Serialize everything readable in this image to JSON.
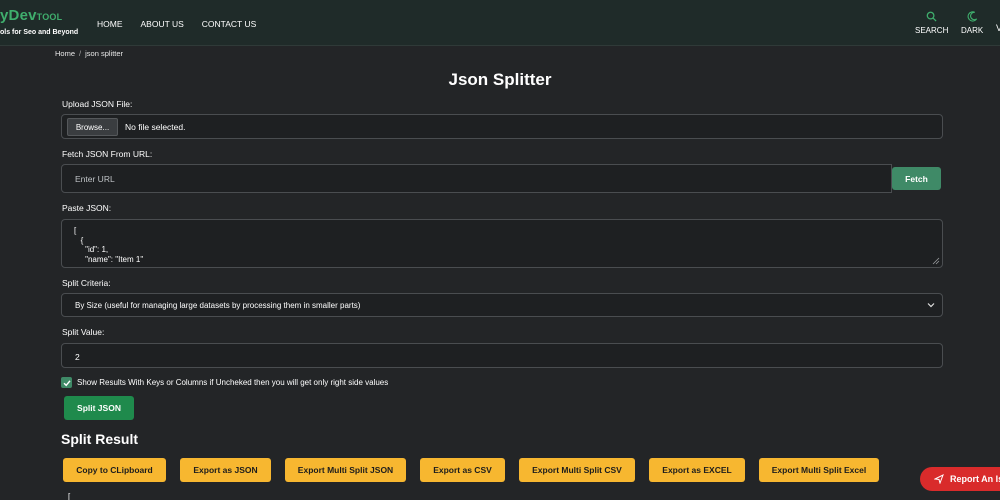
{
  "header": {
    "logo_main": "yDev",
    "logo_tool": "TOOL",
    "logo_tagline": "ols for Seo and Beyond",
    "nav": [
      "HOME",
      "ABOUT US",
      "CONTACT US"
    ],
    "search_label": "SEARCH",
    "dark_label": "DARK",
    "cut_label": "V"
  },
  "breadcrumb": {
    "home": "Home",
    "separator": "/",
    "current": "json splitter"
  },
  "page_title": "Json Splitter",
  "upload": {
    "label": "Upload JSON File:",
    "browse": "Browse...",
    "status": "No file selected."
  },
  "fetch": {
    "label": "Fetch JSON From URL:",
    "placeholder": "Enter URL",
    "button": "Fetch"
  },
  "paste": {
    "label": "Paste JSON:",
    "value": "[\n   {\n     \"id\": 1,\n     \"name\": \"Item 1\""
  },
  "criteria": {
    "label": "Split Criteria:",
    "selected": "By Size (useful for managing large datasets by processing them in smaller parts)"
  },
  "split_value": {
    "label": "Split Value:",
    "value": "2"
  },
  "option": {
    "label": "Show Results With Keys or Columns if Uncheked then you will get only right side values",
    "checked": true
  },
  "split_button": "Split JSON",
  "result": {
    "title": "Split Result",
    "buttons": [
      "Copy to CLipboard",
      "Export as JSON",
      "Export Multi Split JSON",
      "Export as CSV",
      "Export Multi Split CSV",
      "Export as EXCEL",
      "Export Multi Split Excel"
    ],
    "preview": "["
  },
  "report_button": "Report An Issue",
  "colors": {
    "background": "#232527",
    "accent_green": "#3f8a67",
    "split_green": "#1f8a4c",
    "export_yellow": "#f7b730",
    "report_red": "#d92b2b"
  }
}
